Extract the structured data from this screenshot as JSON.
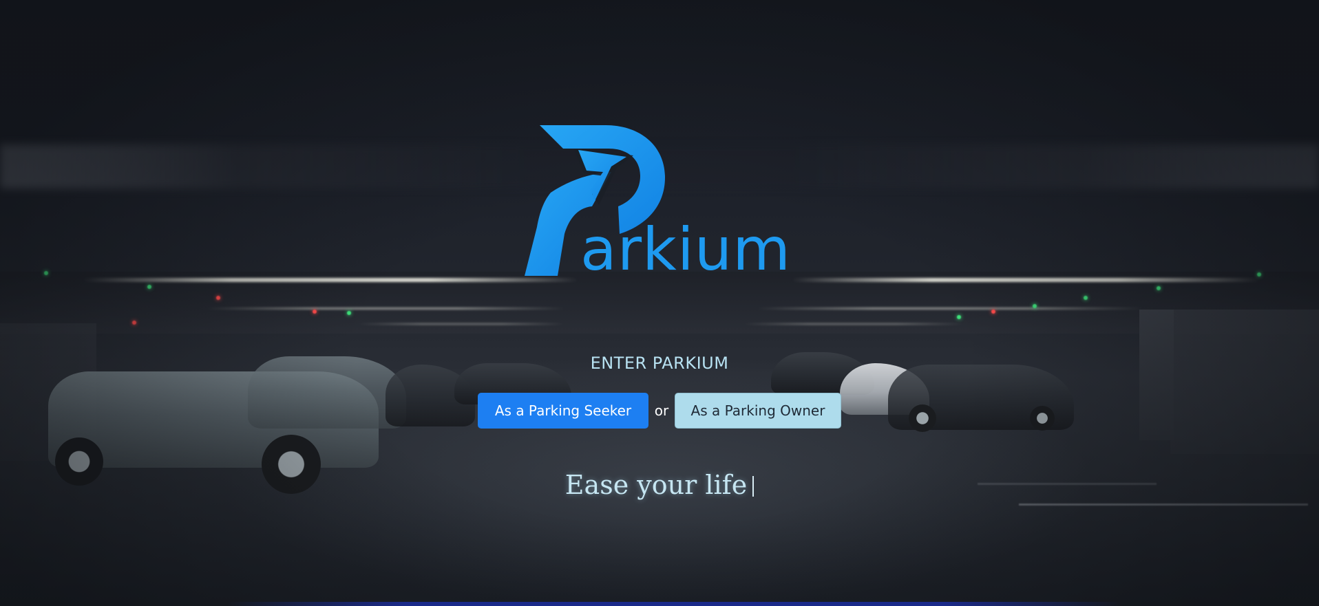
{
  "brand": {
    "name": "Parkium",
    "wordmark": "arkium",
    "logo_icon": "parkium-p-arrow-logo",
    "color": "#1e9af0"
  },
  "entry": {
    "heading": "ENTER PARKIUM",
    "seeker_button": "As a Parking Seeker",
    "separator": "or",
    "owner_button": "As a Parking Owner"
  },
  "tagline": {
    "text": "Ease your life"
  },
  "colors": {
    "seeker_bg": "#1d7ff2",
    "owner_bg": "#aedcec",
    "heading": "#b8e2f2"
  }
}
